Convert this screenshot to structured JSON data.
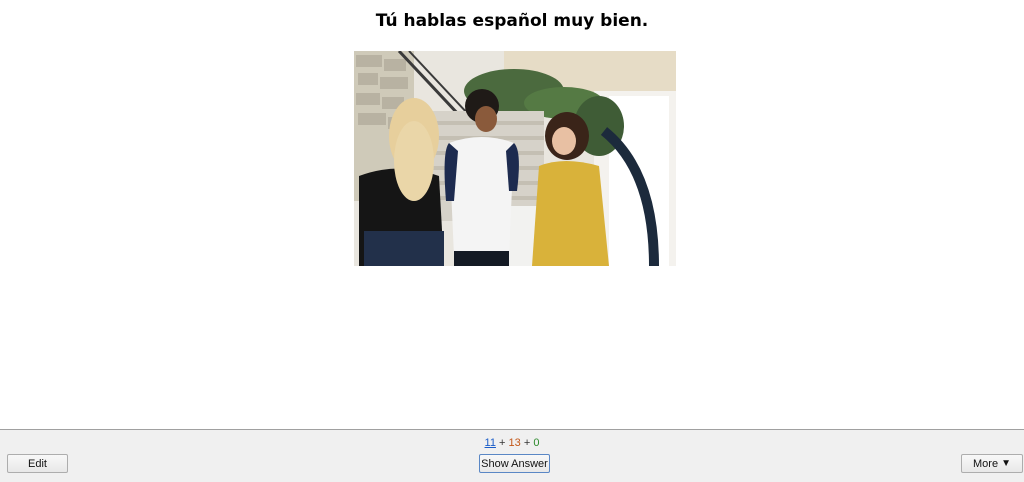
{
  "card": {
    "front_text": "Tú hablas español muy bien."
  },
  "image": {
    "alt": "photo"
  },
  "counts": {
    "new": "11",
    "learning": "13",
    "review": "0",
    "separator": "+",
    "colors": {
      "new": "#1a5cc8",
      "learning": "#c35617",
      "review": "#2c8a2c"
    }
  },
  "buttons": {
    "edit": "Edit",
    "show_answer": "Show Answer",
    "more": "More",
    "more_arrow": "▼"
  }
}
